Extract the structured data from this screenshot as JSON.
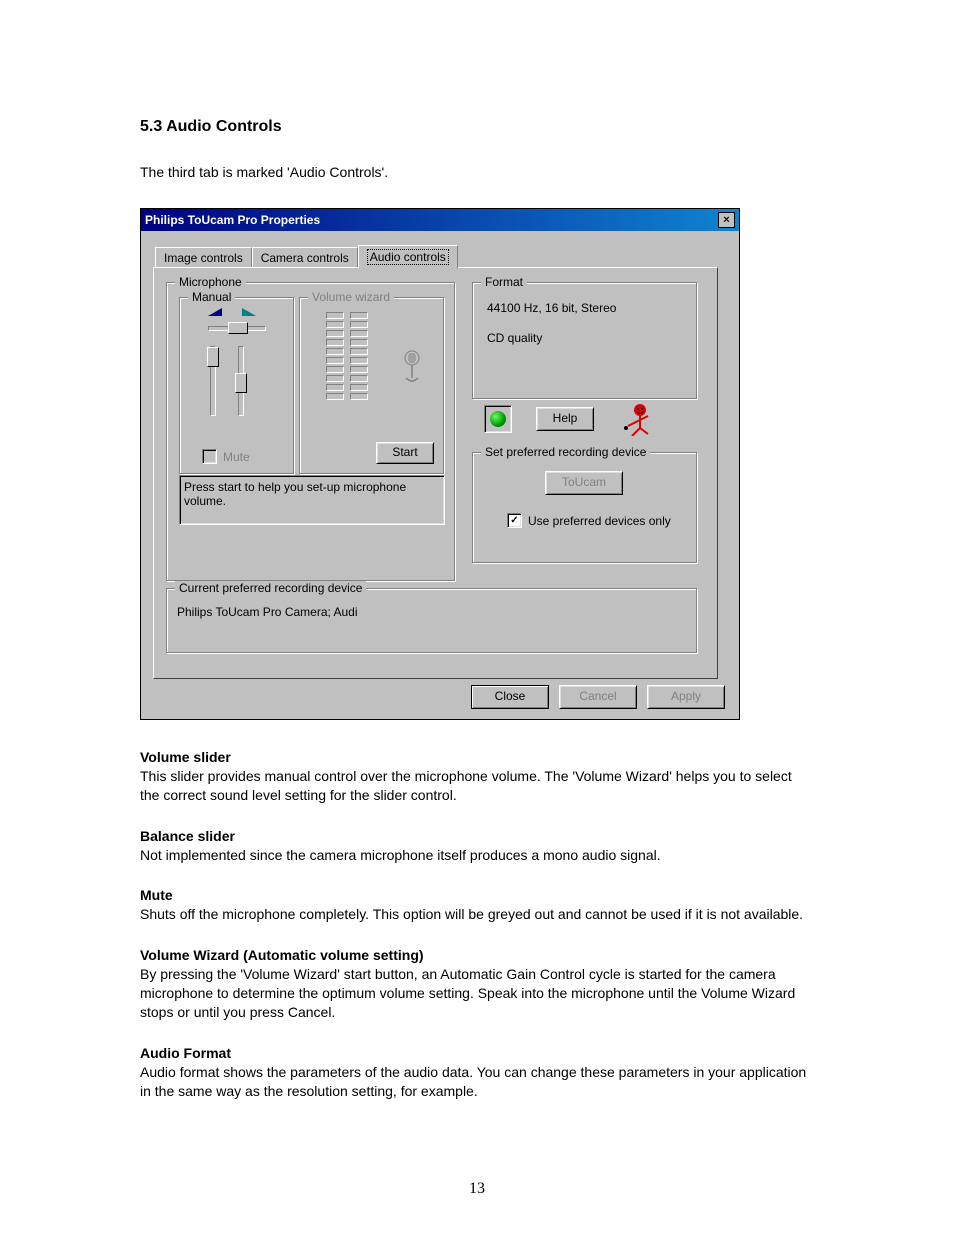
{
  "section": {
    "title": "5.3 Audio Controls",
    "intro": "The third tab is marked 'Audio Controls'."
  },
  "dialog": {
    "title": "Philips ToUcam Pro Properties",
    "tabs": [
      "Image controls",
      "Camera controls",
      "Audio controls"
    ],
    "microphone": {
      "legend": "Microphone",
      "manual_legend": "Manual",
      "wizard_legend": "Volume wizard",
      "mute_label": "Mute",
      "start_button": "Start",
      "hint": "Press start to help you set-up microphone volume."
    },
    "format": {
      "legend": "Format",
      "value": "44100 Hz, 16 bit, Stereo",
      "quality": "CD quality"
    },
    "help_button": "Help",
    "recording": {
      "legend": "Set preferred recording device",
      "device_button": "ToUcam",
      "pref_label": "Use preferred devices only"
    },
    "current": {
      "legend": "Current preferred recording device",
      "value": "Philips ToUcam Pro Camera; Audi"
    },
    "buttons": {
      "close": "Close",
      "cancel": "Cancel",
      "apply": "Apply"
    }
  },
  "desc": {
    "volume_slider_h": "Volume slider",
    "volume_slider_t": "This slider provides manual control over the microphone volume. The 'Volume Wizard' helps you to select the correct sound level setting for the slider control.",
    "balance_h": "Balance slider",
    "balance_t": "Not implemented since the camera microphone itself produces a mono audio signal.",
    "mute_h": "Mute",
    "mute_t": "Shuts off the microphone completely. This option will be greyed out and cannot be used if it is not available.",
    "wizard_h": "Volume Wizard (Automatic volume setting)",
    "wizard_t": "By pressing the 'Volume Wizard' start button, an Automatic Gain Control cycle is started for the camera microphone to determine the optimum volume setting. Speak into the microphone until the Volume Wizard stops or until you press Cancel.",
    "format_h": "Audio Format",
    "format_t": "Audio format shows the parameters of the audio data. You can change these parameters in your application in the same way as the resolution setting, for example."
  },
  "page_number": "13"
}
